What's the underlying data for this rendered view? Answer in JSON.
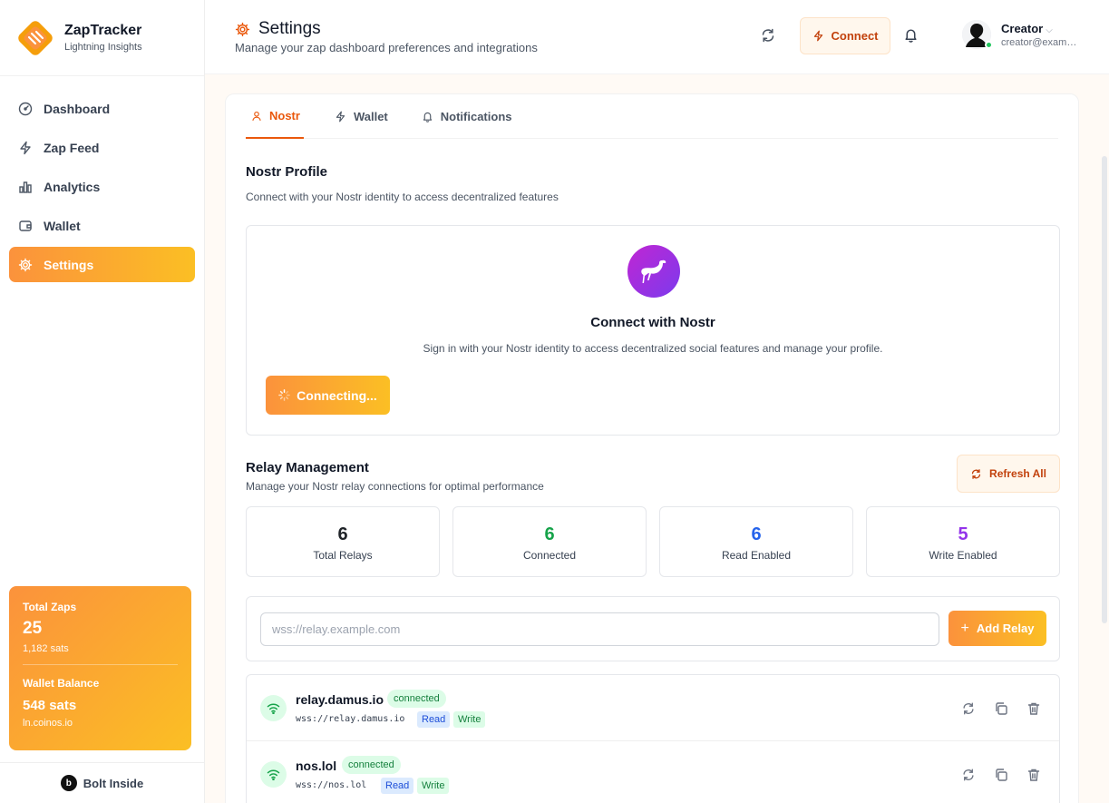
{
  "brand": {
    "name": "ZapTracker",
    "tagline": "Lightning Insights"
  },
  "sidebar": {
    "items": [
      {
        "label": "Dashboard",
        "icon": "gauge-icon"
      },
      {
        "label": "Zap Feed",
        "icon": "bolt-icon"
      },
      {
        "label": "Analytics",
        "icon": "bar-chart-icon"
      },
      {
        "label": "Wallet",
        "icon": "wallet-icon"
      },
      {
        "label": "Settings",
        "icon": "gear-icon",
        "active": true
      }
    ],
    "stats": {
      "zaps_label": "Total Zaps",
      "zaps_count": "25",
      "zaps_sats": "1,182 sats",
      "wallet_label": "Wallet Balance",
      "wallet_value": "548 sats",
      "wallet_address": "ln.coinos.io"
    },
    "footer": {
      "badge": "b",
      "label": "Bolt Inside"
    }
  },
  "header": {
    "title": "Settings",
    "subtitle": "Manage your zap dashboard preferences and integrations",
    "connect_label": "Connect",
    "user": {
      "name": "Creator",
      "email": "creator@example.com",
      "online": true
    }
  },
  "tabs": [
    {
      "label": "Nostr",
      "icon": "user-icon",
      "active": true
    },
    {
      "label": "Wallet",
      "icon": "bolt-icon"
    },
    {
      "label": "Notifications",
      "icon": "bell-icon"
    }
  ],
  "nostr_profile": {
    "title": "Nostr Profile",
    "subtitle": "Connect with your Nostr identity to access decentralized features",
    "connect_title": "Connect with Nostr",
    "connect_desc": "Sign in with your Nostr identity to access decentralized social features and manage your profile.",
    "connect_button": "Connecting..."
  },
  "relay_management": {
    "title": "Relay Management",
    "subtitle": "Manage your Nostr relay connections for optimal performance",
    "refresh_label": "Refresh All",
    "stats": [
      {
        "value": "6",
        "label": "Total Relays",
        "color": "#111827"
      },
      {
        "value": "6",
        "label": "Connected",
        "color": "#16a34a"
      },
      {
        "value": "6",
        "label": "Read Enabled",
        "color": "#2563eb"
      },
      {
        "value": "5",
        "label": "Write Enabled",
        "color": "#9333ea"
      }
    ],
    "input": {
      "placeholder": "wss://relay.example.com",
      "value": ""
    },
    "add_label": "Add Relay",
    "relays": [
      {
        "name": "relay.damus.io",
        "status": "connected",
        "url": "wss://relay.damus.io",
        "read": "Read",
        "write": "Write"
      },
      {
        "name": "nos.lol",
        "status": "connected",
        "url": "wss://nos.lol",
        "read": "Read",
        "write": "Write"
      }
    ]
  },
  "colors": {
    "accent": "#f97316",
    "accent_gradient_end": "#fbbf24",
    "success": "#16a34a",
    "info": "#2563eb",
    "purple": "#9333ea"
  }
}
